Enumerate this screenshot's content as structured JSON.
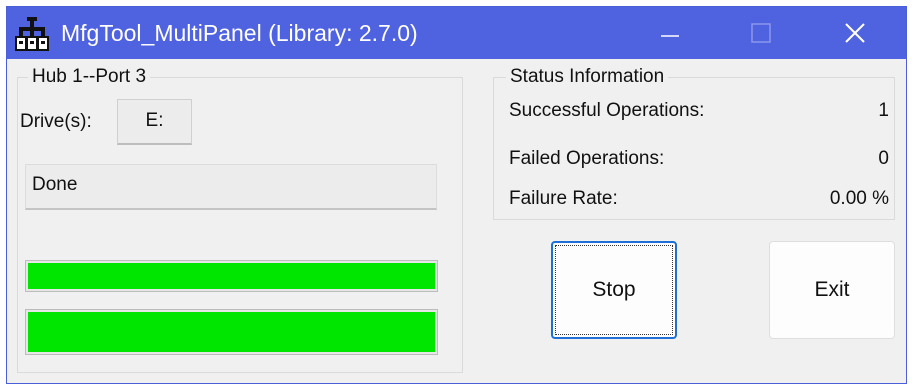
{
  "window": {
    "title": "MfgTool_MultiPanel (Library: 2.7.0)",
    "app_icon": "usb-hub-icon",
    "controls": {
      "minimize": "minimize-icon",
      "maximize": "maximize-icon",
      "close": "close-icon"
    },
    "titlebar_color": "#4f63e0"
  },
  "hub_panel": {
    "title": "Hub 1--Port 3",
    "drive_label": "Drive(s):",
    "drive_value": "E:",
    "status_text": "Done",
    "progress_bars": [
      {
        "fill_fraction": 1.0,
        "color": "#00e600"
      },
      {
        "fill_fraction": 1.0,
        "color": "#00e600"
      }
    ]
  },
  "status_panel": {
    "title": "Status Information",
    "rows": [
      {
        "label": "Successful Operations:",
        "value": "1"
      },
      {
        "label": "Failed Operations:",
        "value": "0"
      },
      {
        "label": "Failure Rate:",
        "value": "0.00 %"
      }
    ]
  },
  "buttons": {
    "stop_label": "Stop",
    "exit_label": "Exit"
  }
}
